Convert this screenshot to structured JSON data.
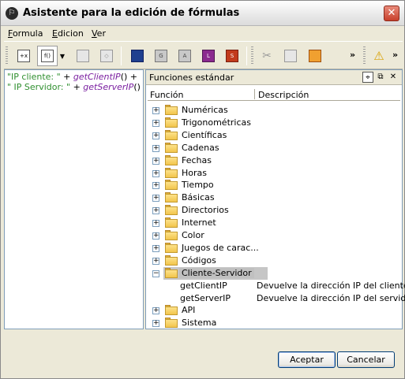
{
  "window": {
    "title": "Asistente para la edición de fórmulas",
    "app_icon_glyph": "⚐",
    "close_glyph": "✕"
  },
  "menu": [
    "Formula",
    "Edicion",
    "Ver"
  ],
  "toolbar": {
    "more_glyph": "»",
    "icons": [
      "insert-field-icon",
      "insert-function-icon",
      "dropdown-arrow-icon",
      "rectangle-icon",
      "eraser-icon",
      "save-icon",
      "text-g-icon",
      "text-a-icon",
      "text-l-icon",
      "text-s-icon",
      "cut-icon",
      "copy-icon",
      "paste-icon",
      "warning-icon"
    ]
  },
  "editor": {
    "line1_str": "\"IP cliente: \"",
    "line1_op": " + ",
    "line1_fn": "getClientIP",
    "line1_tail": "() +",
    "line2_str": "\" IP Servidor: \"",
    "line2_op": " + ",
    "line2_fn": "getServerIP",
    "line2_tail": "()"
  },
  "functions_panel": {
    "title": "Funciones estándar",
    "pin_glyph": "⌖",
    "float_glyph": "⧉",
    "close_glyph": "✕",
    "columns": [
      "Función",
      "Descripción"
    ],
    "categories": [
      {
        "label": "Numéricas",
        "expanded": false
      },
      {
        "label": "Trigonométricas",
        "expanded": false
      },
      {
        "label": "Científicas",
        "expanded": false
      },
      {
        "label": "Cadenas",
        "expanded": false
      },
      {
        "label": "Fechas",
        "expanded": false
      },
      {
        "label": "Horas",
        "expanded": false
      },
      {
        "label": "Tiempo",
        "expanded": false
      },
      {
        "label": "Básicas",
        "expanded": false
      },
      {
        "label": "Directorios",
        "expanded": false
      },
      {
        "label": "Internet",
        "expanded": false
      },
      {
        "label": "Color",
        "expanded": false
      },
      {
        "label": "Juegos de carac...",
        "expanded": false
      },
      {
        "label": "Códigos",
        "expanded": false
      },
      {
        "label": "Cliente-Servidor",
        "expanded": true,
        "selected": true
      },
      {
        "label": "API",
        "expanded": false
      },
      {
        "label": "Sistema",
        "expanded": false
      }
    ],
    "client_server_functions": [
      {
        "name": "getClientIP",
        "description": "Devuelve la dirección IP del cliente"
      },
      {
        "name": "getServerIP",
        "description": "Devuelve la dirección IP del servidor"
      }
    ],
    "expand_glyph": "+",
    "collapse_glyph": "−"
  },
  "buttons": {
    "accept": "Aceptar",
    "cancel": "Cancelar"
  },
  "colors": {
    "string_literal": "#2f8f2f",
    "function_name": "#7a1fa0",
    "selection": "#c6c6c6"
  }
}
